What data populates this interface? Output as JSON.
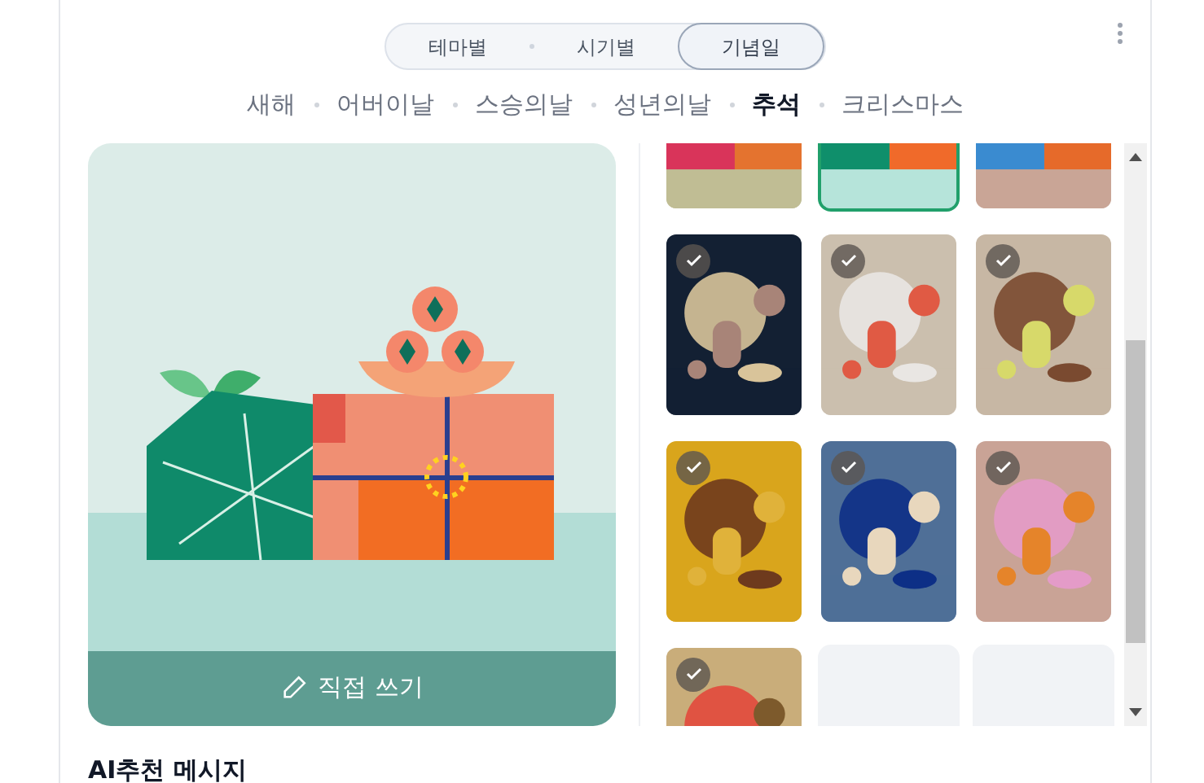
{
  "segments": [
    {
      "label": "테마별",
      "selected": false
    },
    {
      "label": "시기별",
      "selected": false
    },
    {
      "label": "기념일",
      "selected": true
    }
  ],
  "occasions": [
    {
      "label": "새해",
      "selected": false
    },
    {
      "label": "어버이날",
      "selected": false
    },
    {
      "label": "스승의날",
      "selected": false
    },
    {
      "label": "성년의날",
      "selected": false
    },
    {
      "label": "추석",
      "selected": true
    },
    {
      "label": "크리스마스",
      "selected": false
    }
  ],
  "preview": {
    "button": "직접 쓰기"
  },
  "cards": [
    {
      "kind": "cut",
      "selected": false
    },
    {
      "kind": "cut",
      "selected": true
    },
    {
      "kind": "cut",
      "selected": false
    },
    {
      "kind": "picture",
      "selected": false
    },
    {
      "kind": "picture",
      "selected": false
    },
    {
      "kind": "picture",
      "selected": false
    },
    {
      "kind": "picture",
      "selected": false
    },
    {
      "kind": "picture",
      "selected": false
    },
    {
      "kind": "picture",
      "selected": false
    },
    {
      "kind": "picture",
      "selected": false
    },
    {
      "kind": "empty",
      "selected": false
    },
    {
      "kind": "empty",
      "selected": false
    }
  ],
  "section_title": "AI추천 메시지"
}
